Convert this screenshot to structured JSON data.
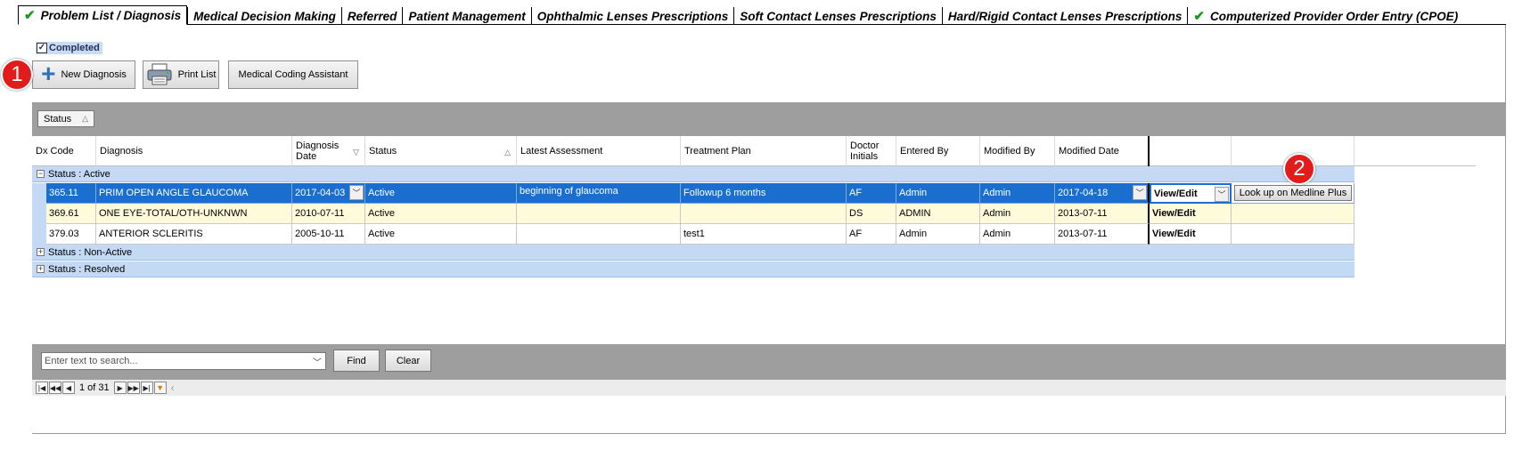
{
  "tabs": [
    {
      "label": "Problem List / Diagnosis",
      "checked": true,
      "active": true
    },
    {
      "label": "Medical Decision Making",
      "checked": false
    },
    {
      "label": "Referred",
      "checked": false
    },
    {
      "label": "Patient Management",
      "checked": false
    },
    {
      "label": "Ophthalmic Lenses Prescriptions",
      "checked": false
    },
    {
      "label": "Soft Contact Lenses Prescriptions",
      "checked": false
    },
    {
      "label": "Hard/Rigid Contact Lenses Prescriptions",
      "checked": false
    },
    {
      "label": "Computerized Provider Order Entry (CPOE)",
      "checked": true
    }
  ],
  "completed": {
    "label": "Completed",
    "checked": true,
    "mark": "✓"
  },
  "toolbar": {
    "new_diagnosis": "New Diagnosis",
    "print_list": "Print List",
    "coding_assistant": "Medical Coding Assistant"
  },
  "callouts": {
    "one": "1",
    "two": "2"
  },
  "grid": {
    "group_by_chip": "Status",
    "columns": {
      "dx_code": "Dx Code",
      "diagnosis": "Diagnosis",
      "diagnosis_date_1": "Diagnosis",
      "diagnosis_date_2": "Date",
      "status": "Status",
      "latest_assessment": "Latest Assessment",
      "treatment_plan": "Treatment Plan",
      "doctor_initials_1": "Doctor",
      "doctor_initials_2": "Initials",
      "entered_by": "Entered By",
      "modified_by": "Modified By",
      "modified_date": "Modified Date"
    },
    "groups": {
      "active": "Status : Active",
      "non_active": "Status : Non-Active",
      "resolved": "Status : Resolved"
    },
    "rows": [
      {
        "dx_code": "365.11",
        "diagnosis": "PRIM OPEN ANGLE GLAUCOMA",
        "diagnosis_date": "2017-04-03",
        "status": "Active",
        "latest_assessment": "beginning of glaucoma",
        "treatment_plan": "Followup 6 months",
        "doctor_initials": "AF",
        "entered_by": "Admin",
        "modified_by": "Admin",
        "modified_date": "2017-04-18",
        "action": "View/Edit",
        "lookup": "Look up on Medline Plus"
      },
      {
        "dx_code": "369.61",
        "diagnosis": "ONE EYE-TOTAL/OTH-UNKNWN",
        "diagnosis_date": "2010-07-11",
        "status": "Active",
        "latest_assessment": "",
        "treatment_plan": "",
        "doctor_initials": "DS",
        "entered_by": "ADMIN",
        "modified_by": "Admin",
        "modified_date": "2013-07-11",
        "action": "View/Edit"
      },
      {
        "dx_code": "379.03",
        "diagnosis": "ANTERIOR SCLERITIS",
        "diagnosis_date": "2005-10-11",
        "status": "Active",
        "latest_assessment": "",
        "treatment_plan": "test1",
        "doctor_initials": "AF",
        "entered_by": "Admin",
        "modified_by": "Admin",
        "modified_date": "2013-07-11",
        "action": "View/Edit"
      }
    ]
  },
  "footer": {
    "search_placeholder": "Enter text to search...",
    "find": "Find",
    "clear": "Clear",
    "page_info": "1 of 31"
  },
  "icons": {
    "check": "check-icon",
    "plus": "plus-icon",
    "printer": "printer-icon",
    "sort": "sort-triangle-icon",
    "expand": "expand-icon",
    "collapse": "collapse-icon",
    "first": "first-page-icon",
    "prev_block": "prev-block-icon",
    "prev": "prev-page-icon",
    "next": "next-page-icon",
    "next_block": "next-block-icon",
    "last": "last-page-icon",
    "filter": "filter-icon"
  },
  "colors": {
    "selected_row": "#1a6fce",
    "alt_row": "#fdfbd9",
    "group_row": "#c3d9f4",
    "panel_gray": "#9e9e9e",
    "callout_red": "#e21b1b",
    "check_green": "#1a9a1a"
  }
}
